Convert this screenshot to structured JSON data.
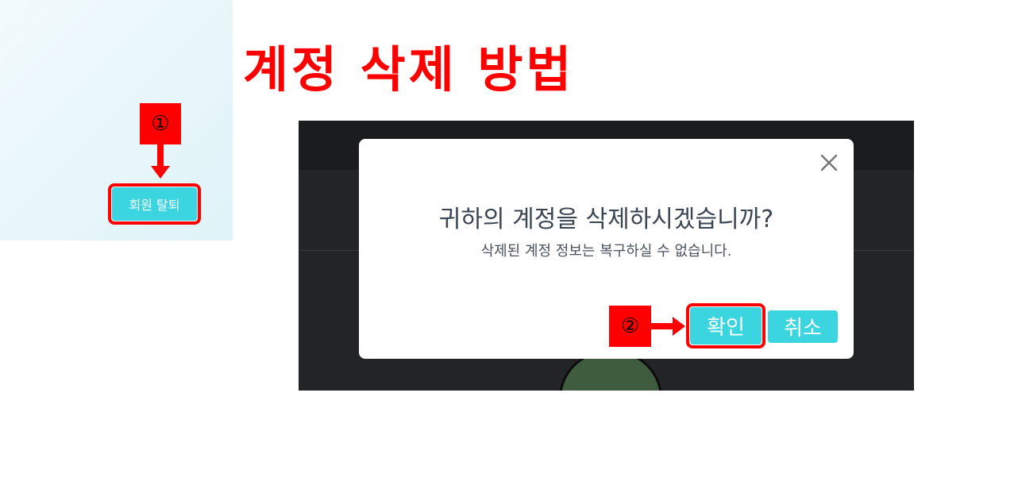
{
  "title": "계정 삭제 방법",
  "steps": {
    "step1": "①",
    "step2": "②"
  },
  "left_panel": {
    "withdraw_button": "회원 탈퇴"
  },
  "dialog": {
    "title": "귀하의 계정을 삭제하시겠습니까?",
    "subtitle": "삭제된 계정 정보는 복구하실 수 없습니다.",
    "confirm_label": "확인",
    "cancel_label": "취소",
    "close_icon": "close-icon"
  },
  "colors": {
    "accent_red": "#ff0000",
    "button_teal": "#3bd5e0",
    "screenshot_bg": "#232426"
  }
}
